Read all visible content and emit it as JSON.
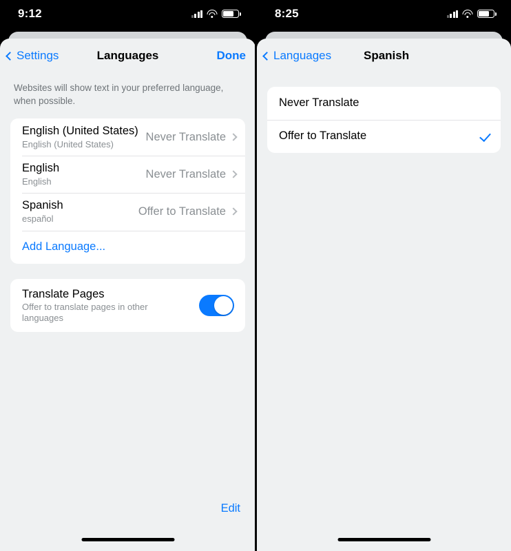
{
  "left_panel": {
    "status_bar": {
      "time": "9:12",
      "signal_icon": "cellular-signal-icon",
      "wifi_icon": "wifi-icon",
      "battery_icon": "battery-icon"
    },
    "nav": {
      "back_label": "Settings",
      "title": "Languages",
      "action_label": "Done"
    },
    "footnote": "Websites will show text in your preferred language, when possible.",
    "languages": [
      {
        "title": "English (United States)",
        "subtitle": "English (United States)",
        "value": "Never Translate"
      },
      {
        "title": "English",
        "subtitle": "English",
        "value": "Never Translate"
      },
      {
        "title": "Spanish",
        "subtitle": "español",
        "value": "Offer to Translate"
      }
    ],
    "add_language_label": "Add Language...",
    "translate_pages": {
      "title": "Translate Pages",
      "subtitle": "Offer to translate pages in other languages",
      "enabled": true
    },
    "edit_label": "Edit"
  },
  "right_panel": {
    "status_bar": {
      "time": "8:25",
      "signal_icon": "cellular-signal-icon",
      "wifi_icon": "wifi-icon",
      "battery_icon": "battery-icon"
    },
    "nav": {
      "back_label": "Languages",
      "title": "Spanish"
    },
    "options": [
      {
        "label": "Never Translate",
        "selected": false
      },
      {
        "label": "Offer to Translate",
        "selected": true
      }
    ]
  },
  "colors": {
    "accent": "#0A7AFF",
    "sheet_background": "#EFF1F2",
    "card_background": "#FFFFFF",
    "secondary_text": "#8A8F93",
    "separator": "#E2E3E5"
  }
}
